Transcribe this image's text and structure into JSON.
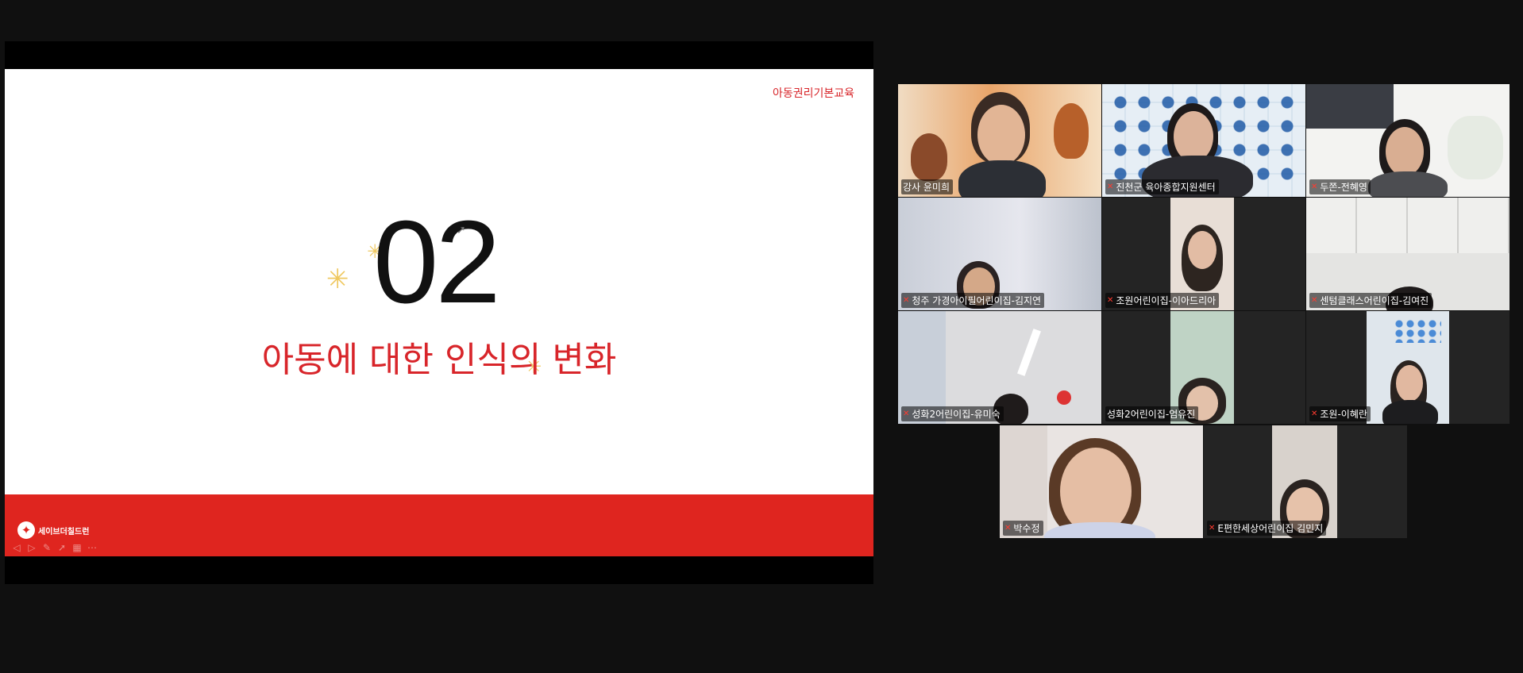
{
  "slide": {
    "header": "아동권리기본교육",
    "number": "02",
    "title": "아동에 대한 인식의 변화",
    "logo_text": "세이브더칠드런"
  },
  "participants": [
    {
      "name": "강사 윤미희",
      "muted": false,
      "active": true
    },
    {
      "name": "진천군 육아종합지원센터",
      "muted": true,
      "active": false
    },
    {
      "name": "두쫀-전혜영",
      "muted": true,
      "active": false
    },
    {
      "name": "청주 가경아이필어린이집-김지연",
      "muted": true,
      "active": false
    },
    {
      "name": "조원어린이집-이아드리아",
      "muted": true,
      "active": false
    },
    {
      "name": "센텀클래스어린이집-김여진",
      "muted": true,
      "active": false
    },
    {
      "name": "성화2어린이집-유미숙",
      "muted": true,
      "active": false
    },
    {
      "name": "성화2어린이집-엄유진",
      "muted": false,
      "active": false
    },
    {
      "name": "조원-이혜란",
      "muted": true,
      "active": false
    },
    {
      "name": "박수정",
      "muted": true,
      "active": false
    },
    {
      "name": "E편한세상어린이집 김민지",
      "muted": true,
      "active": false
    }
  ],
  "colors": {
    "accent_red": "#df251f",
    "active_speaker_border": "#2ed36f",
    "background": "#101010"
  },
  "icons": {
    "muted": "mic-off-icon"
  }
}
